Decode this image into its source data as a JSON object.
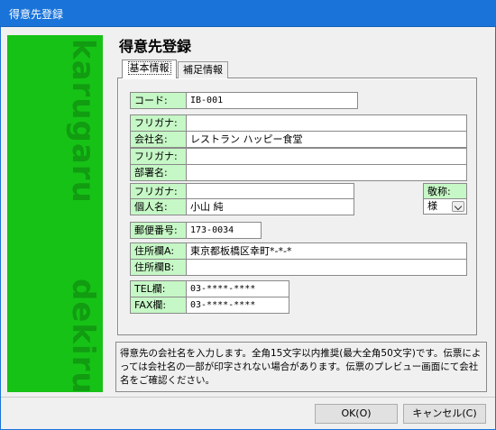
{
  "window": {
    "title": "得意先登録"
  },
  "banner": {
    "watermark_top": "karugaru",
    "watermark_bottom": "dekiru"
  },
  "heading": "得意先登録",
  "tabs": [
    {
      "label": "基本情報",
      "selected": true
    },
    {
      "label": "補足情報",
      "selected": false
    }
  ],
  "form": {
    "code": {
      "label": "コード:",
      "value": "IB-001"
    },
    "company_kana": {
      "label": "フリガナ:",
      "value": ""
    },
    "company_name": {
      "label": "会社名:",
      "value": "レストラン ハッピー食堂"
    },
    "dept_kana": {
      "label": "フリガナ:",
      "value": ""
    },
    "dept_name": {
      "label": "部署名:",
      "value": ""
    },
    "person_kana": {
      "label": "フリガナ:",
      "value": ""
    },
    "person_name": {
      "label": "個人名:",
      "value": "小山 純"
    },
    "honorific": {
      "label": "敬称:",
      "value": "様"
    },
    "postal": {
      "label": "郵便番号:",
      "value": "173-0034"
    },
    "address_a": {
      "label": "住所欄A:",
      "value": "東京都板橋区幸町*-*-*"
    },
    "address_b": {
      "label": "住所欄B:",
      "value": ""
    },
    "tel": {
      "label": "TEL欄:",
      "value": "03-****-****"
    },
    "fax": {
      "label": "FAX欄:",
      "value": "03-****-****"
    }
  },
  "help_text": "得意先の会社名を入力します。全角15文字以内推奨(最大全角50文字)です。伝票によっては会社名の一部が印字されない場合があります。伝票のプレビュー画面にて会社名をご確認ください。",
  "buttons": {
    "ok": "OK(O)",
    "cancel": "キャンセル(C)"
  },
  "colors": {
    "titlebar": "#1a73d9",
    "banner": "#16c216",
    "label_bg": "#c6f7c6"
  }
}
